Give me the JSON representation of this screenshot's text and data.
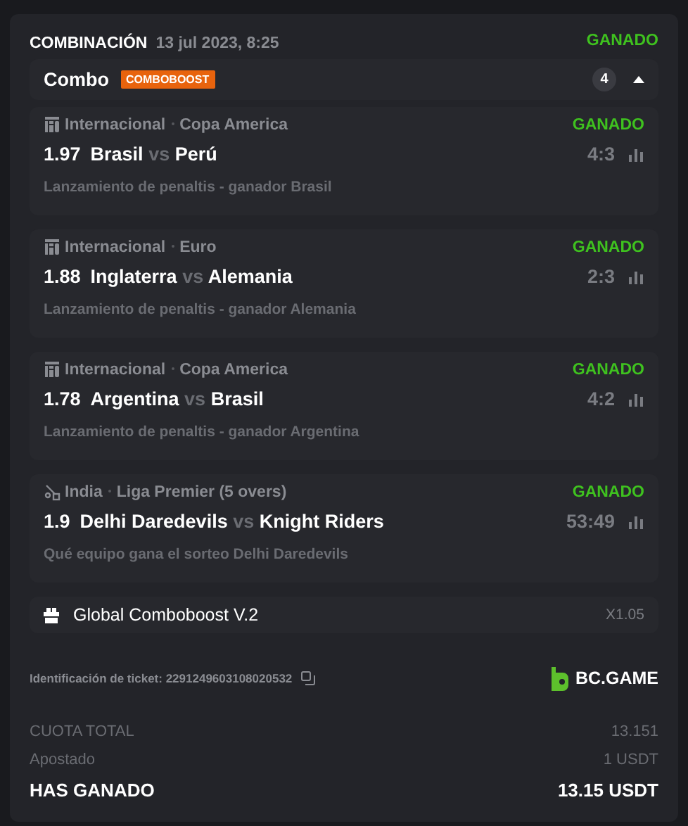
{
  "header": {
    "title": "COMBINACIÓN",
    "date": "13 jul 2023, 8:25",
    "status": "GANADO"
  },
  "combo": {
    "label": "Combo",
    "badge": "COMBOBOOST",
    "count": "4",
    "expanded": true
  },
  "legs": [
    {
      "kind": "esoccer",
      "region": "Internacional",
      "league": "Copa America",
      "status": "GANADO",
      "odds": "1.97",
      "home": "Brasil",
      "vs": "vs",
      "away": "Perú",
      "score": "4:3",
      "market": "Lanzamiento de penaltis - ganador Brasil"
    },
    {
      "kind": "esoccer",
      "region": "Internacional",
      "league": "Euro",
      "status": "GANADO",
      "odds": "1.88",
      "home": "Inglaterra",
      "vs": "vs",
      "away": "Alemania",
      "score": "2:3",
      "market": "Lanzamiento de penaltis - ganador Alemania"
    },
    {
      "kind": "esoccer",
      "region": "Internacional",
      "league": "Copa America",
      "status": "GANADO",
      "odds": "1.78",
      "home": "Argentina",
      "vs": "vs",
      "away": "Brasil",
      "score": "4:2",
      "market": "Lanzamiento de penaltis - ganador Argentina"
    },
    {
      "kind": "cricket",
      "region": "India",
      "league": "Liga Premier (5 overs)",
      "status": "GANADO",
      "odds": "1.9",
      "home": "Delhi Daredevils",
      "vs": "vs",
      "away": "Knight Riders",
      "score": "53:49",
      "market": "Qué equipo gana el sorteo Delhi Daredevils"
    }
  ],
  "boost": {
    "label": "Global Comboboost V.2",
    "multiplier": "X1.05"
  },
  "ticket": {
    "label": "Identificación de ticket: 2291249603108020532",
    "brand": "BC.GAME"
  },
  "totals": [
    {
      "kind": "plain",
      "label": "CUOTA TOTAL",
      "value": "13.151"
    },
    {
      "kind": "plain",
      "label": "Apostado",
      "value": "1 USDT"
    },
    {
      "kind": "strong",
      "label": "HAS GANADO",
      "value": "13.15 USDT"
    }
  ]
}
